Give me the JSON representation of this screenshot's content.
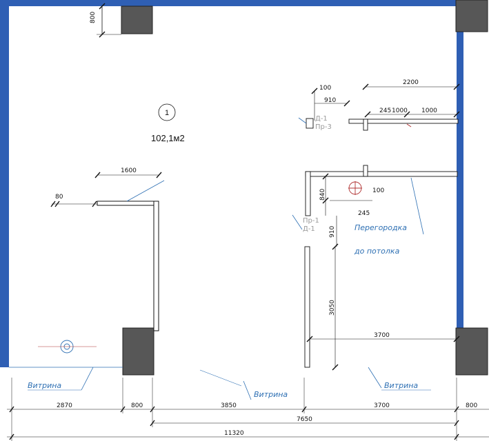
{
  "room": {
    "number": "1",
    "area": "102,1м2"
  },
  "dimensions": {
    "top_column": "800",
    "d100_top": "100",
    "d910_top": "910",
    "d2200": "2200",
    "d245_top": "245",
    "d1000_a": "1000",
    "d1000_b": "1000",
    "d1600": "1600",
    "d80": "80",
    "d840": "840",
    "d100_mid": "100",
    "d245_mid": "245",
    "d910_mid": "910",
    "d3050": "3050",
    "d3700_inner": "3700",
    "bottom_row1": [
      "2870",
      "800",
      "3850",
      "3700",
      "800"
    ],
    "bottom_7650": "7650",
    "bottom_11320": "11320"
  },
  "labels": {
    "vitrina_left": "Витрина",
    "vitrina_center": "Витрина",
    "vitrina_right": "Витрина",
    "partition_line1": "Перегородка",
    "partition_line2": "до потолка",
    "door_top_d": "Д-1",
    "door_top_pr": "Пр-3",
    "door_mid_pr": "Пр-1",
    "door_mid_d": "Д-1"
  },
  "colors": {
    "wall_blue": "#2f5fb4",
    "column_fill": "#575757",
    "label_blue": "#2d6fb3",
    "wall_hatch": "#b03030"
  }
}
